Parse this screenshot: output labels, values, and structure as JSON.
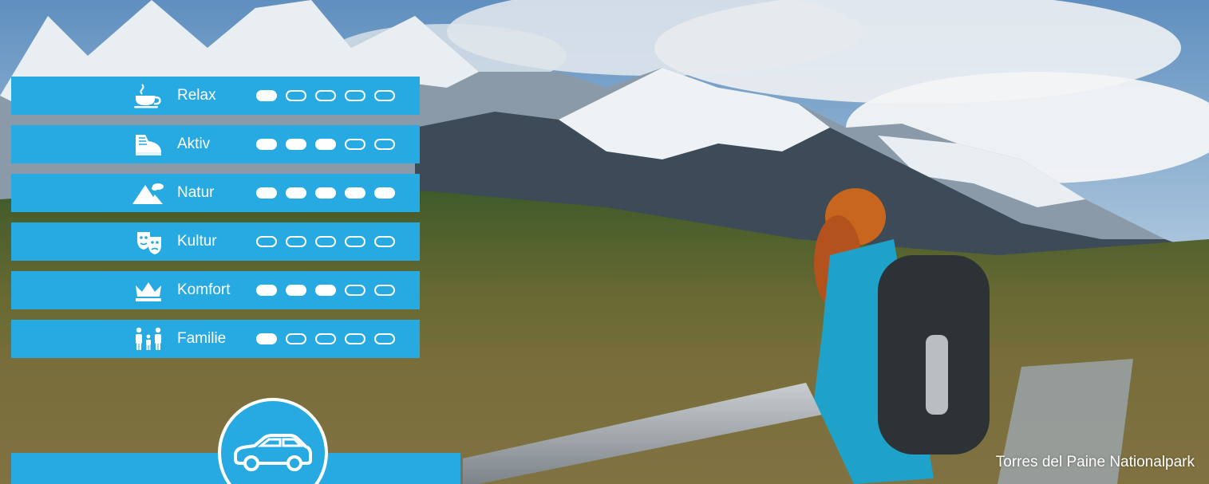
{
  "colors": {
    "accent": "#27aae1",
    "text": "#ffffff"
  },
  "rating_scale_max": 5,
  "ratings": [
    {
      "label": "Relax",
      "icon": "coffee-cup-icon",
      "level": 1
    },
    {
      "label": "Aktiv",
      "icon": "hiking-boot-icon",
      "level": 3
    },
    {
      "label": "Natur",
      "icon": "mountain-cloud-icon",
      "level": 5
    },
    {
      "label": "Kultur",
      "icon": "theater-masks-icon",
      "level": 0
    },
    {
      "label": "Komfort",
      "icon": "crown-icon",
      "level": 3
    },
    {
      "label": "Familie",
      "icon": "family-icon",
      "level": 1
    }
  ],
  "transport": {
    "icon": "car-icon"
  },
  "caption": "Torres del Paine Nationalpark"
}
